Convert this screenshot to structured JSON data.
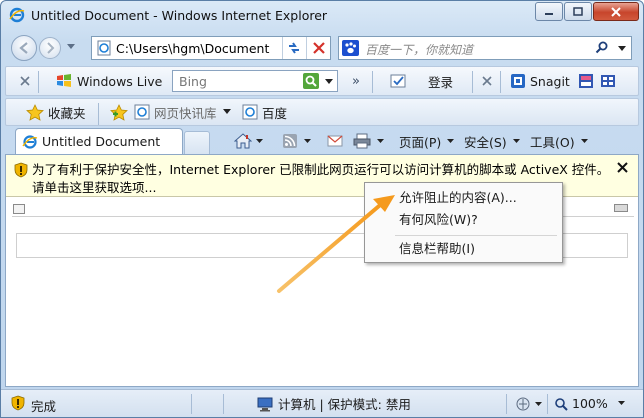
{
  "window": {
    "title": "Untitled Document - Windows Internet Explorer"
  },
  "address": {
    "url": "C:\\Users\\hgm\\Document"
  },
  "search": {
    "placeholder": "百度一下，你就知道"
  },
  "toolbar1": {
    "windows_live": "Windows Live",
    "bing_placeholder": "Bing",
    "login": "登录",
    "snagit": "Snagit",
    "chevron": "»"
  },
  "toolbar2": {
    "favorites": "收藏夹",
    "web_slices": "网页快讯库",
    "baidu": "百度"
  },
  "tab": {
    "label": "Untitled Document"
  },
  "commands": {
    "page": "页面(P)",
    "safety": "安全(S)",
    "tools": "工具(O)"
  },
  "infobar": {
    "message": "为了有利于保护安全性，Internet Explorer 已限制此网页运行可以访问计算机的脚本或 ActiveX 控件。请单击这里获取选项..."
  },
  "context_menu": {
    "items": [
      {
        "label": "允许阻止的内容(A)..."
      },
      {
        "label": "有何风险(W)?"
      },
      {
        "label": "信息栏帮助(I)"
      }
    ]
  },
  "status": {
    "text": "完成",
    "zone": "计算机 | 保护模式: 禁用",
    "zoom": "100%"
  },
  "colors": {
    "infobar_bg": "#ffffe1",
    "arrow": "#f5a623",
    "close_red": "#c7452c"
  }
}
